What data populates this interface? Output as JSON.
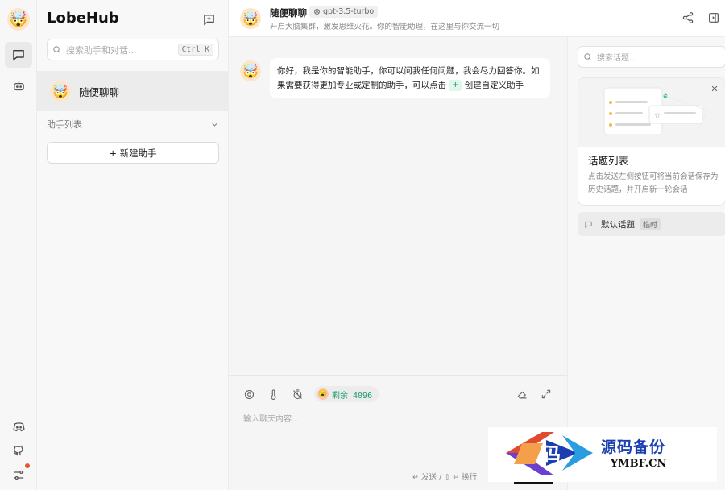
{
  "app": {
    "brand": "LobeHub"
  },
  "rail": {
    "avatar_emoji": "🤯",
    "icons": [
      "chat-icon",
      "bot-icon",
      "discord-icon",
      "github-icon",
      "settings-icon"
    ]
  },
  "sessions": {
    "search_placeholder": "搜索助手和对话...",
    "search_shortcut": "Ctrl K",
    "items": [
      {
        "emoji": "🤯",
        "name": "随便聊聊"
      }
    ],
    "group_label": "助手列表",
    "create_label": "+ 新建助手"
  },
  "chat": {
    "title": "随便聊聊",
    "model": "gpt-3.5-turbo",
    "description": "开启大脑集群，激发思维火花。你的智能助理，在这里与你交流一切",
    "message": {
      "line1": "你好，我是你的智能助手，你可以问我任何问题，我会尽力回答你。如",
      "line2_pre": "果需要获得更加专业或定制的助手，可以点击",
      "plus": "+",
      "line2_post": "创建自定义助手"
    }
  },
  "composer": {
    "token_label": "剩余 4096",
    "placeholder": "输入聊天内容...",
    "hint": "↵ 发送 / ⇧ ↵ 换行"
  },
  "topics": {
    "search_placeholder": "搜索话题...",
    "card_title": "话题列表",
    "card_desc": "点击发送左侧按钮可将当前会话保存为历史话题，并开启新一轮会话",
    "items": [
      {
        "name": "默认话题",
        "tag": "临时"
      }
    ]
  },
  "watermark": {
    "cn": "源码备份",
    "en": "YMBF.CN",
    "logo_char": "码"
  },
  "colors": {
    "accent_green": "#1a9a6a",
    "notify_dot": "#e4572e",
    "watermark_blue": "#1b3fb0",
    "watermark_orange": "#f4a04a"
  }
}
